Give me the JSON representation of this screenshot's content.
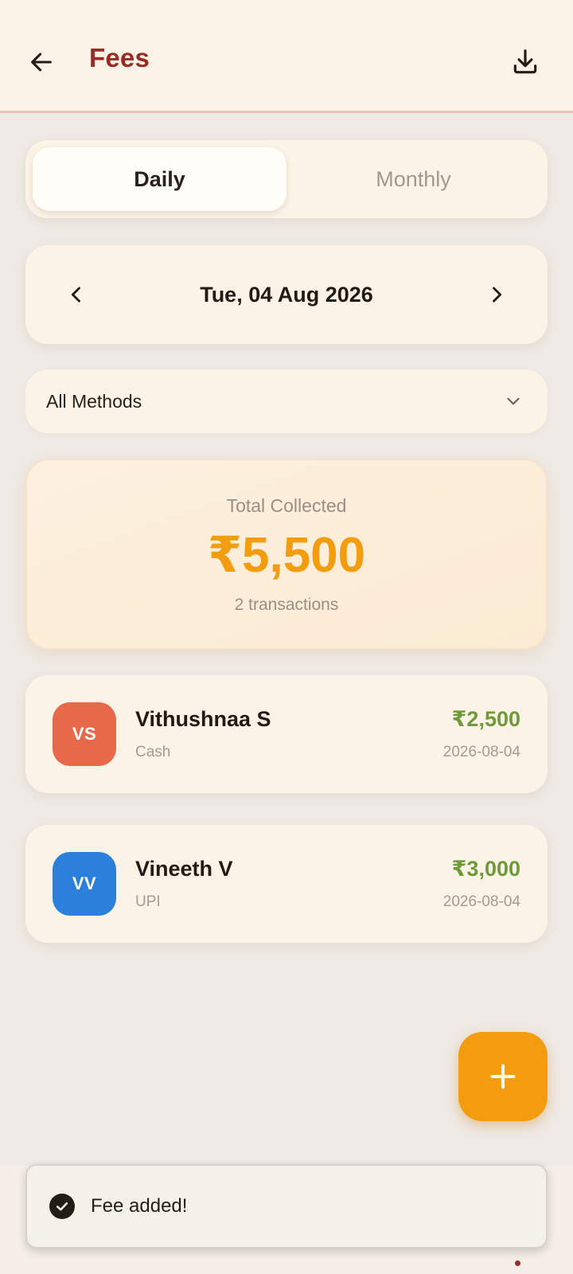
{
  "header": {
    "title": "Fees",
    "back_icon": "arrow-left-icon",
    "download_icon": "download-icon"
  },
  "tabs": [
    {
      "label": "Daily",
      "active": true
    },
    {
      "label": "Monthly",
      "active": false
    }
  ],
  "date_nav": {
    "date": "Tue, 04 Aug 2026",
    "prev_icon": "chevron-left-icon",
    "next_icon": "chevron-right-icon"
  },
  "filter": {
    "selected": "All Methods",
    "icon": "chevron-down-icon"
  },
  "summary": {
    "caption": "Total Collected",
    "amount": "₹5,500",
    "count": "2 transactions"
  },
  "transactions": [
    {
      "initials": "VS",
      "name": "Vithushnaa S",
      "method": "Cash",
      "amount": "₹2,500",
      "date": "2026-08-04",
      "avatar_color": "#e8684a"
    },
    {
      "initials": "VV",
      "name": "Vineeth V",
      "method": "UPI",
      "amount": "₹3,000",
      "date": "2026-08-04",
      "avatar_color": "#2b80db"
    }
  ],
  "fab": {
    "icon": "plus-icon"
  },
  "snackbar": {
    "message": "Fee added!",
    "icon": "check-circle-icon"
  },
  "colors": {
    "brand": "#9a2a24",
    "accent": "#f39d0e",
    "amount_green": "#6f9a3a"
  }
}
